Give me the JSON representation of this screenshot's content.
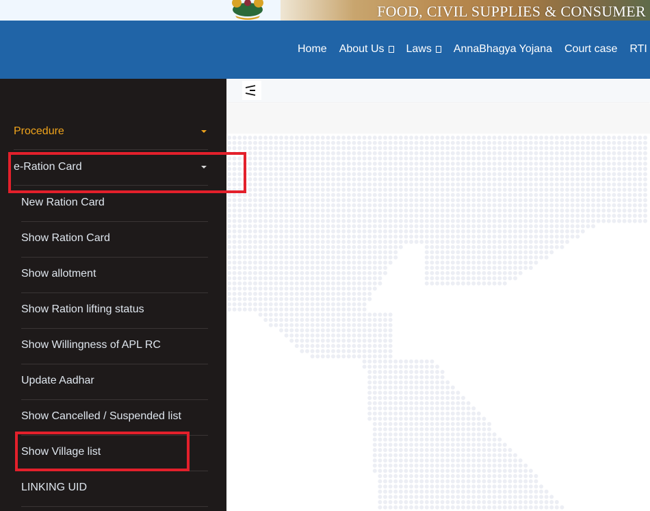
{
  "banner": {
    "title": "FOOD, CIVIL SUPPLIES & CONSUMER",
    "emblem_icon": "karnataka-emblem-icon"
  },
  "nav": {
    "items": [
      {
        "label": "Home",
        "has_dropdown": false
      },
      {
        "label": "About Us",
        "has_dropdown": true
      },
      {
        "label": "Laws",
        "has_dropdown": true
      },
      {
        "label": "AnnaBhagya Yojana",
        "has_dropdown": false
      },
      {
        "label": "Court case",
        "has_dropdown": false
      },
      {
        "label": "RTI",
        "has_dropdown": false
      }
    ]
  },
  "sidebar": {
    "sections": [
      {
        "label": "Procedure",
        "active": true
      },
      {
        "label": "e-Ration Card",
        "active": false,
        "expanded": true
      }
    ],
    "sub_items": [
      {
        "label": "New Ration Card"
      },
      {
        "label": "Show Ration Card"
      },
      {
        "label": "Show allotment"
      },
      {
        "label": "Show Ration lifting status"
      },
      {
        "label": "Show Willingness of APL RC"
      },
      {
        "label": "Update Aadhar"
      },
      {
        "label": "Show Cancelled / Suspended list"
      },
      {
        "label": "Show Village list"
      },
      {
        "label": "LINKING UID"
      }
    ]
  },
  "toolbar": {
    "toggle_icon": "sidebar-toggle-icon"
  },
  "annotations": {
    "highlighted": [
      "e-Ration Card",
      "Show Village list"
    ],
    "color": "#e3202b"
  },
  "colors": {
    "navbar": "#2064a7",
    "sidebar": "#1e1a1a",
    "active_item": "#f0a41c"
  }
}
